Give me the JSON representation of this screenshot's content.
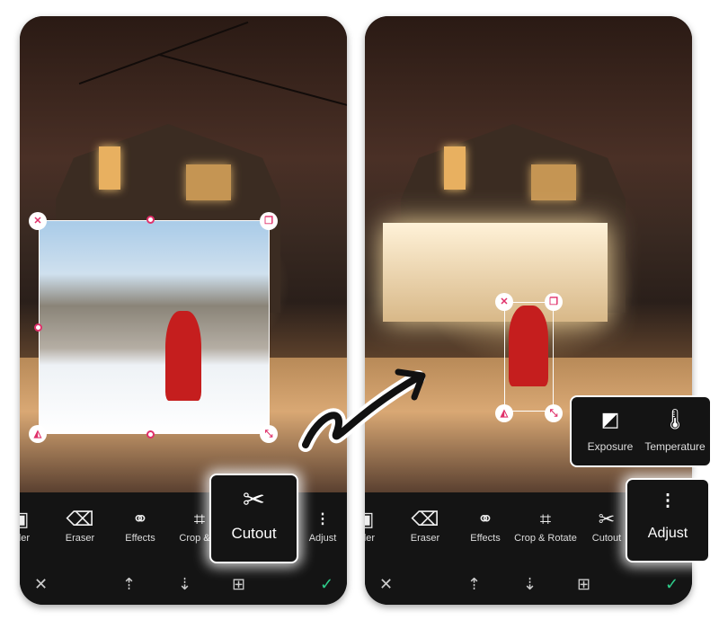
{
  "left_phone": {
    "tools": [
      {
        "label": "ader",
        "icon": "border-icon"
      },
      {
        "label": "Eraser",
        "icon": "eraser-icon"
      },
      {
        "label": "Effects",
        "icon": "effects-icon"
      },
      {
        "label": "Crop & R",
        "icon": "crop-rotate-icon"
      },
      {
        "label": "Adjust",
        "icon": "adjust-icon"
      }
    ],
    "highlight": {
      "label": "Cutout",
      "icon": "scissors-icon"
    }
  },
  "right_phone": {
    "tools": [
      {
        "label": "ader",
        "icon": "border-icon"
      },
      {
        "label": "Eraser",
        "icon": "eraser-icon"
      },
      {
        "label": "Effects",
        "icon": "effects-icon"
      },
      {
        "label": "Crop & Rotate",
        "icon": "crop-rotate-icon"
      },
      {
        "label": "Cutout",
        "icon": "scissors-icon"
      }
    ],
    "highlight": {
      "label": "Adjust",
      "icon": "adjust-icon"
    },
    "popup": [
      {
        "label": "Exposure",
        "icon": "exposure-icon"
      },
      {
        "label": "Temperature",
        "icon": "thermometer-icon"
      }
    ]
  },
  "colors": {
    "accent": "#e0306a",
    "confirm": "#2ecc8a",
    "toolbar": "#141414"
  }
}
